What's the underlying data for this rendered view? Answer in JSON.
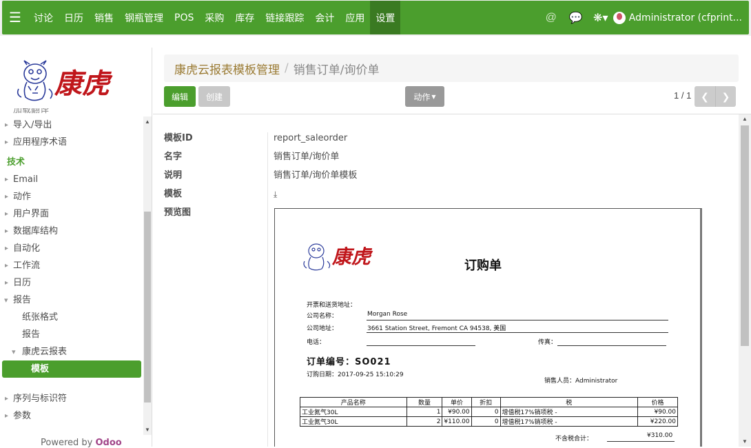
{
  "topbar": {
    "menu": [
      "讨论",
      "日历",
      "销售",
      "钢瓶管理",
      "POS",
      "采购",
      "库存",
      "链接跟踪",
      "会计",
      "应用",
      "设置"
    ],
    "active_index": 10,
    "user_name": "Administrator (cfprint...",
    "accent": "#4b9e2d"
  },
  "sidebar": {
    "logo_text": "康虎",
    "items": [
      {
        "label": "加载翻译",
        "kind": "clipped"
      },
      {
        "label": "导入/导出",
        "kind": "caret"
      },
      {
        "label": "应用程序术语",
        "kind": "caret"
      },
      {
        "label": "技术",
        "kind": "section"
      },
      {
        "label": "Email",
        "kind": "caret"
      },
      {
        "label": "动作",
        "kind": "caret"
      },
      {
        "label": "用户界面",
        "kind": "caret"
      },
      {
        "label": "数据库结构",
        "kind": "caret"
      },
      {
        "label": "自动化",
        "kind": "caret"
      },
      {
        "label": "工作流",
        "kind": "caret"
      },
      {
        "label": "日历",
        "kind": "caret"
      },
      {
        "label": "报告",
        "kind": "caret-open"
      },
      {
        "label": "纸张格式",
        "kind": "lvl2"
      },
      {
        "label": "报告",
        "kind": "lvl2"
      },
      {
        "label": "康虎云报表",
        "kind": "lvl2-open"
      },
      {
        "label": "模板",
        "kind": "active"
      },
      {
        "label": "",
        "kind": "spacer"
      },
      {
        "label": "序列与标识符",
        "kind": "caret"
      },
      {
        "label": "参数",
        "kind": "caret"
      }
    ],
    "powered_prefix": "Powered by ",
    "powered_brand": "Odoo"
  },
  "breadcrumb": {
    "parent": "康虎云报表模板管理",
    "separator": "/",
    "current": "销售订单/询价单"
  },
  "buttons": {
    "edit": "编辑",
    "create": "创建",
    "action": "动作"
  },
  "pager": {
    "text": "1 / 1"
  },
  "form": {
    "labels": {
      "template_id": "模板ID",
      "name": "名字",
      "description": "说明",
      "template": "模板",
      "preview": "预览图"
    },
    "values": {
      "template_id": "report_saleorder",
      "name": "销售订单/询价单",
      "description": "销售订单/询价单模板"
    }
  },
  "preview_doc": {
    "logo_text": "康虎",
    "title": "订购单",
    "address_heading": "开票和送货地址：",
    "company_label": "公司名称：",
    "company_value": "Morgan Rose",
    "address_label": "公司地址：",
    "address_value": "3661 Station Street, Fremont CA 94538, 美国",
    "phone_label": "电话：",
    "fax_label": "传真：",
    "order_no_label": "订单编号：",
    "order_no": "SO021",
    "order_date": "订购日期：2017-09-25  15:10:29",
    "salesperson": "销售人员：Administrator",
    "table": {
      "headers": [
        "产品名称",
        "数量",
        "单价",
        "折扣",
        "税",
        "价格"
      ],
      "rows": [
        [
          "工业氮气30L",
          "1",
          "¥90.00",
          "0",
          "增值税17%销项税 -",
          "¥90.00"
        ],
        [
          "工业氮气30L",
          "2",
          "¥110.00",
          "0",
          "增值税17%销项税 -",
          "¥220.00"
        ]
      ]
    },
    "untaxed_label": "不含税合计：",
    "untaxed_value": "¥310.00"
  }
}
